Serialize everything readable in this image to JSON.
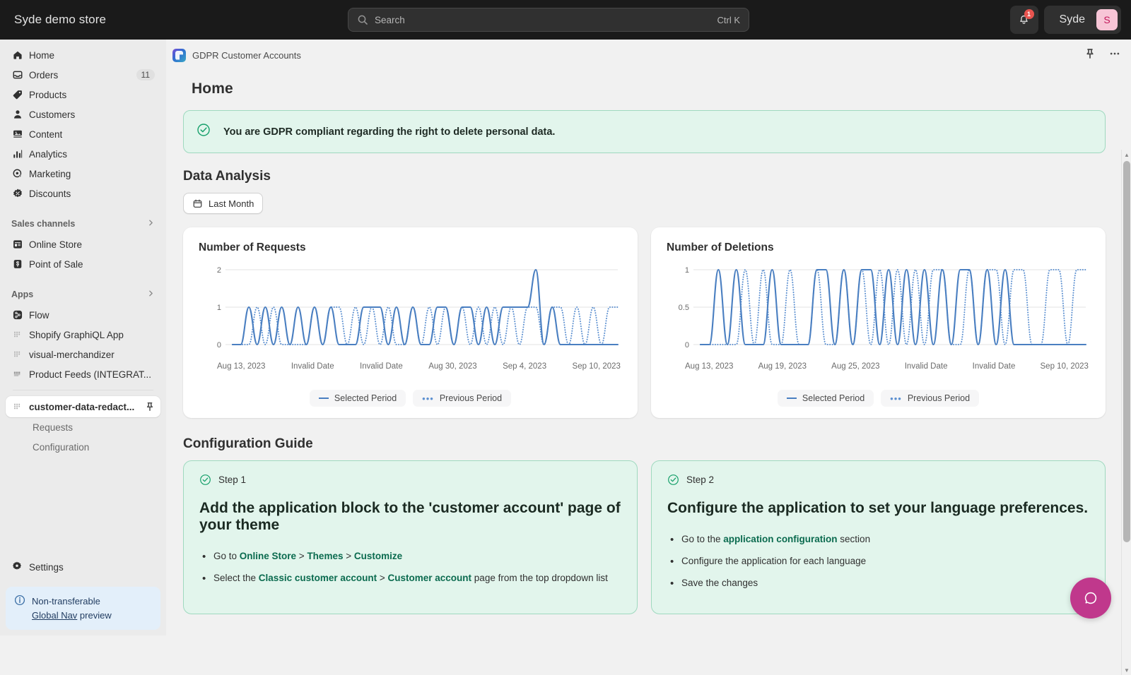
{
  "topbar": {
    "store_name": "Syde demo store",
    "search": {
      "placeholder": "Search",
      "shortcut": "Ctrl K",
      "icon": "search-icon"
    },
    "notifications": {
      "count": "1",
      "icon": "bell-icon"
    },
    "user": {
      "name": "Syde",
      "avatar_initial": "S",
      "avatar_bg": "#f7c5d6"
    }
  },
  "sidebar": {
    "main_items": [
      {
        "label": "Home",
        "icon": "home-icon",
        "badge": ""
      },
      {
        "label": "Orders",
        "icon": "orders-inbox-icon",
        "badge": "11"
      },
      {
        "label": "Products",
        "icon": "tag-icon",
        "badge": ""
      },
      {
        "label": "Customers",
        "icon": "person-icon",
        "badge": ""
      },
      {
        "label": "Content",
        "icon": "content-image-icon",
        "badge": ""
      },
      {
        "label": "Analytics",
        "icon": "bar-chart-icon",
        "badge": ""
      },
      {
        "label": "Marketing",
        "icon": "target-cursor-icon",
        "badge": ""
      },
      {
        "label": "Discounts",
        "icon": "discount-badge-icon",
        "badge": ""
      }
    ],
    "sales_channels": {
      "label": "Sales channels",
      "chevron": "chevron-right-icon",
      "items": [
        {
          "label": "Online Store",
          "icon": "storefront-icon"
        },
        {
          "label": "Point of Sale",
          "icon": "pos-icon"
        }
      ]
    },
    "apps": {
      "label": "Apps",
      "chevron": "chevron-right-icon",
      "items": [
        {
          "label": "Flow",
          "icon": "flow-icon"
        },
        {
          "label": "Shopify GraphiQL App",
          "icon": "app-placeholder-icon"
        },
        {
          "label": "visual-merchandizer",
          "icon": "app-placeholder-icon"
        },
        {
          "label": "Product Feeds (INTEGRAT...",
          "icon": "app-placeholder-icon"
        }
      ]
    },
    "active_app": {
      "label": "customer-data-redact...",
      "icon": "app-placeholder-icon",
      "pin_icon": "pin-icon",
      "sub_items": [
        {
          "label": "Requests"
        },
        {
          "label": "Configuration"
        }
      ]
    },
    "settings": {
      "label": "Settings",
      "icon": "gear-icon"
    },
    "global_nav_note": {
      "icon": "info-circle-icon",
      "line1": "Non-transferable",
      "link": "Global Nav",
      "suffix": " preview"
    }
  },
  "app_header": {
    "favicon": "gdpr-app-favicon",
    "title": "GDPR Customer Accounts",
    "pin_icon": "pin-icon",
    "more_icon": "ellipsis-horizontal-icon"
  },
  "page": {
    "title": "Home",
    "banner": {
      "icon": "check-circle-icon",
      "text": "You are GDPR compliant regarding the right to delete personal data.",
      "bg": "#e2f5ec",
      "border": "#9fd9bf"
    },
    "data_analysis": {
      "title": "Data Analysis",
      "date_range_button": {
        "label": "Last Month",
        "icon": "calendar-icon"
      }
    },
    "configuration_guide": {
      "title": "Configuration Guide",
      "steps": [
        {
          "badge_icon": "check-circle-icon",
          "step_label": "Step 1",
          "title": "Add the application block to the 'customer account' page of your theme",
          "bullets": [
            {
              "prefix": "Go to ",
              "strong1": "Online Store",
              "mid1": " > ",
              "strong2": "Themes",
              "mid2": " > ",
              "strong3": "Customize",
              "suffix": ""
            },
            {
              "prefix": "Select the ",
              "strong1": "Classic customer account",
              "mid1": " > ",
              "strong2": "Customer account",
              "mid2": "",
              "strong3": "",
              "suffix": " page from the top dropdown list"
            }
          ]
        },
        {
          "badge_icon": "check-circle-icon",
          "step_label": "Step 2",
          "title": "Configure the application to set your language preferences.",
          "bullets": [
            {
              "prefix": "Go to the ",
              "strong1": "application configuration",
              "mid1": "",
              "strong2": "",
              "mid2": "",
              "strong3": "",
              "suffix": " section"
            },
            {
              "prefix": "Configure the application for each language",
              "strong1": "",
              "mid1": "",
              "strong2": "",
              "mid2": "",
              "strong3": "",
              "suffix": ""
            },
            {
              "prefix": "Save the changes",
              "strong1": "",
              "mid1": "",
              "strong2": "",
              "mid2": "",
              "strong3": "",
              "suffix": ""
            }
          ]
        }
      ]
    },
    "help_button": {
      "icon": "chat-bubble-icon",
      "color": "#c0388c"
    }
  },
  "chart_data": [
    {
      "type": "line",
      "title": "Number of Requests",
      "xlabel": "",
      "ylabel": "",
      "ylim": [
        0,
        2
      ],
      "yticks": [
        0,
        1,
        2
      ],
      "ytick_labels": [
        "0",
        "2",
        "1"
      ],
      "grid": true,
      "legend_position": "bottom",
      "xtick_labels": [
        "Aug 13, 2023",
        "Invalid Date",
        "Invalid Date",
        "Aug 30, 2023",
        "Sep 4, 2023",
        "Sep 10, 2023"
      ],
      "series": [
        {
          "name": "Selected Period",
          "style": "solid",
          "color": "#4a7fc1",
          "values": [
            0,
            0,
            1,
            0,
            1,
            0,
            1,
            0,
            1,
            0,
            1,
            0,
            1,
            0,
            0,
            0,
            1,
            1,
            1,
            0,
            1,
            0,
            1,
            0,
            0,
            1,
            1,
            0,
            1,
            1,
            0,
            1,
            0,
            1,
            1,
            1,
            1,
            2,
            0,
            1,
            0,
            0,
            0,
            0,
            0,
            0,
            0,
            0
          ]
        },
        {
          "name": "Previous Period",
          "style": "dotted",
          "color": "#5b8fd0",
          "values": [
            0,
            0,
            0,
            1,
            0,
            1,
            0,
            0,
            0,
            0,
            1,
            0,
            1,
            1,
            0,
            1,
            0,
            1,
            0,
            1,
            0,
            0,
            1,
            0,
            1,
            0,
            1,
            0,
            1,
            0,
            1,
            0,
            1,
            0,
            1,
            0,
            1,
            1,
            0,
            1,
            1,
            0,
            1,
            0,
            1,
            0,
            1,
            1
          ]
        }
      ]
    },
    {
      "type": "line",
      "title": "Number of Deletions",
      "xlabel": "",
      "ylabel": "",
      "ylim": [
        0,
        1
      ],
      "yticks": [
        0,
        0.5,
        1
      ],
      "ytick_labels": [
        "0",
        "0.5",
        "1"
      ],
      "grid": true,
      "legend_position": "bottom",
      "xtick_labels": [
        "Aug 13, 2023",
        "Aug 19, 2023",
        "Aug 25, 2023",
        "Invalid Date",
        "Invalid Date",
        "Sep 10, 2023"
      ],
      "series": [
        {
          "name": "Selected Period",
          "style": "solid",
          "color": "#4a7fc1",
          "values": [
            0,
            0,
            1,
            0,
            1,
            0,
            0,
            0,
            1,
            0,
            0,
            0,
            0,
            1,
            1,
            0,
            1,
            0,
            1,
            1,
            0,
            1,
            0,
            1,
            0,
            1,
            0,
            1,
            0,
            1,
            1,
            0,
            1,
            0,
            1,
            0,
            0,
            0,
            0,
            0,
            0,
            0,
            0,
            0
          ]
        },
        {
          "name": "Previous Period",
          "style": "dotted",
          "color": "#5b8fd0",
          "values": [
            0,
            0,
            0,
            0,
            0,
            1,
            0,
            1,
            0,
            0,
            1,
            0,
            0,
            1,
            0,
            0,
            1,
            0,
            1,
            0,
            1,
            0,
            1,
            0,
            1,
            0,
            1,
            1,
            0,
            0,
            1,
            0,
            1,
            1,
            0,
            1,
            1,
            0,
            0,
            1,
            1,
            0,
            1,
            1
          ]
        }
      ]
    }
  ],
  "legend_labels": {
    "selected": "Selected Period",
    "previous": "Previous Period"
  }
}
